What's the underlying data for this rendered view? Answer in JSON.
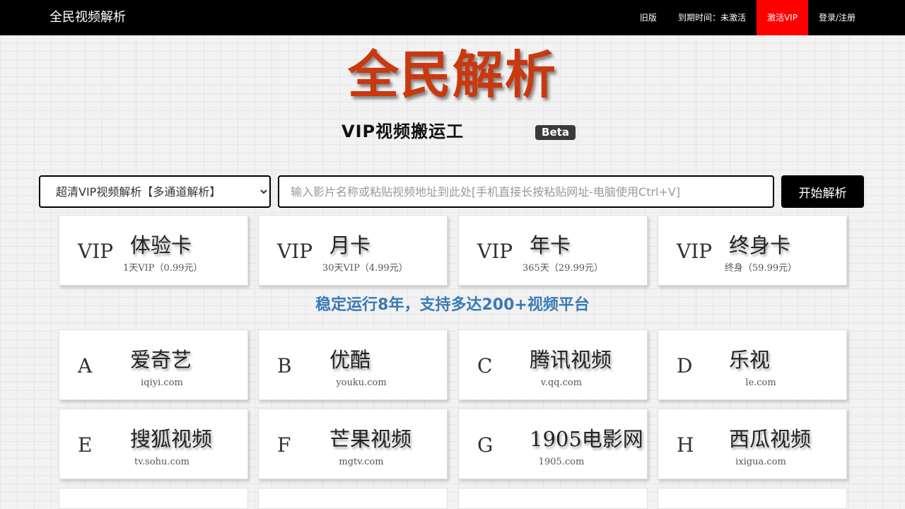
{
  "nav": {
    "brand": "全民视频解析",
    "links": [
      {
        "label": "旧版"
      },
      {
        "label": "到期时间：未激活"
      },
      {
        "label": "激活VIP"
      },
      {
        "label": "登录/注册"
      }
    ]
  },
  "hero": {
    "title": "全民解析",
    "slogan": "VIP视频搬运工",
    "badge": "Beta"
  },
  "search": {
    "channel_selected": "超清VIP视频解析【多通道解析】",
    "placeholder": "输入影片名称或粘贴视频地址到此处[手机直接长按粘贴网址-电脑使用Ctrl+V]",
    "button": "开始解析"
  },
  "plans": [
    {
      "letter": "VIP",
      "title": "体验卡",
      "sub": "1天VIP（0.99元）"
    },
    {
      "letter": "VIP",
      "title": "月卡",
      "sub": "30天VIP（4.99元）"
    },
    {
      "letter": "VIP",
      "title": "年卡",
      "sub": "365天（29.99元）"
    },
    {
      "letter": "VIP",
      "title": "终身卡",
      "sub": "终身（59.99元）"
    }
  ],
  "tagline": "稳定运行8年，支持多达200+视频平台",
  "platforms": [
    {
      "letter": "A",
      "title": "爱奇艺",
      "sub": "iqiyi.com"
    },
    {
      "letter": "B",
      "title": "优酷",
      "sub": "youku.com"
    },
    {
      "letter": "C",
      "title": "腾讯视频",
      "sub": "v.qq.com"
    },
    {
      "letter": "D",
      "title": "乐视",
      "sub": "le.com"
    },
    {
      "letter": "E",
      "title": "搜狐视频",
      "sub": "tv.sohu.com"
    },
    {
      "letter": "F",
      "title": "芒果视频",
      "sub": "mgtv.com"
    },
    {
      "letter": "G",
      "title": "1905电影网",
      "sub": "1905.com"
    },
    {
      "letter": "H",
      "title": "西瓜视频",
      "sub": "ixigua.com"
    }
  ]
}
